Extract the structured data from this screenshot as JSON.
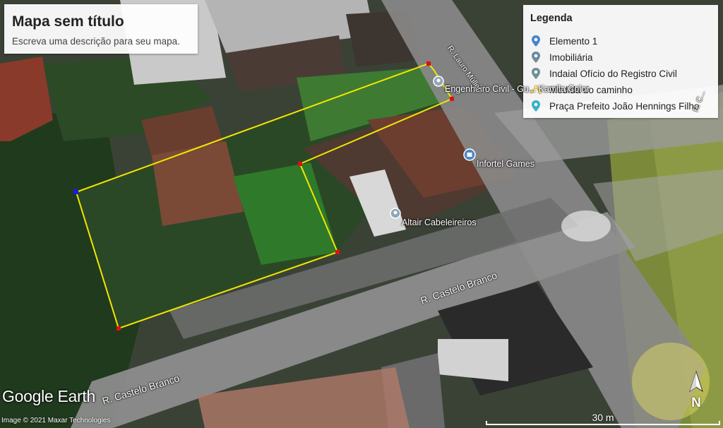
{
  "map": {
    "title": "Mapa sem título",
    "description": "Escreva uma descrição para seu mapa."
  },
  "legend": {
    "title": "Legenda",
    "items": [
      {
        "label": "Elemento 1",
        "icon": "pin-icon",
        "color": "#4a86c8"
      },
      {
        "label": "Imobiliária",
        "icon": "pin-icon",
        "color": "#6e8aa0"
      },
      {
        "label": "Indaial Ofício do Registro Civil",
        "icon": "pin-icon",
        "color": "#6f8f98"
      },
      {
        "label": "Medida do caminho",
        "icon": "path-measure-icon",
        "color": "#e0c020"
      },
      {
        "label": "Praça Prefeito João Hennings Filho",
        "icon": "pin-icon",
        "color": "#39b0c8"
      }
    ]
  },
  "places": [
    {
      "label": "Engenheiro Civil - Gu... Kamila Color",
      "icon": "pin-icon"
    },
    {
      "label": "Infortel Games",
      "icon": "store-pin-icon"
    },
    {
      "label": "Altair Cabeleireiros",
      "icon": "pin-icon"
    }
  ],
  "roads": {
    "castelo_branco_1": "R. Castelo Branco",
    "castelo_branco_2": "R. Castelo Branco",
    "lauro_muller": "R. Lauro Müller",
    "right_street": "R. C..."
  },
  "branding": {
    "logo": "Google Earth",
    "copyright": "Image © 2021 Maxar Technologies"
  },
  "scale": {
    "label": "30 m"
  },
  "compass": {
    "label": "N"
  },
  "colors": {
    "measure_line": "#f2e600",
    "vertex": "#e01010",
    "start_vertex": "#1020e0"
  }
}
